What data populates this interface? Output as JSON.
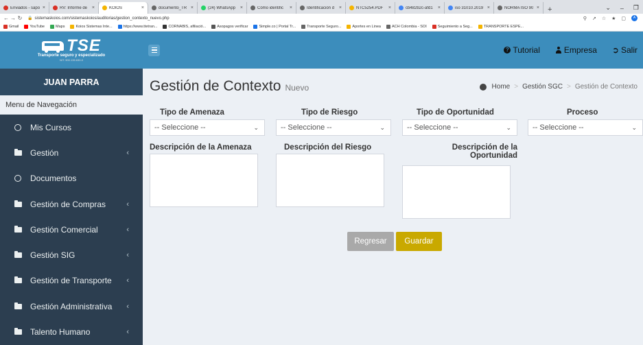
{
  "browser": {
    "tabs": [
      {
        "label": "Enviados - sapo",
        "color": "#d93025"
      },
      {
        "label": "RV: Informe de",
        "color": "#d93025"
      },
      {
        "label": "KOIOS",
        "color": "#f4b400",
        "active": true
      },
      {
        "label": "documento_TR",
        "color": "#666666"
      },
      {
        "label": "(24) WhatsApp",
        "color": "#25d366"
      },
      {
        "label": "Cómo identific",
        "color": "#666666"
      },
      {
        "label": "Identificación d",
        "color": "#666666"
      },
      {
        "label": "NTC5254.PDF",
        "color": "#f4b400"
      },
      {
        "label": "cb482b2c-afd1",
        "color": "#4285f4"
      },
      {
        "label": "iso 31010.2019",
        "color": "#4285f4"
      },
      {
        "label": "NORMA ISO 90",
        "color": "#666666"
      }
    ],
    "url": "sistemaskoios.com/sistemaskoios/auditorias/gestion_contexto_nuevo.php",
    "profile_initial": "A",
    "bookmarks": [
      {
        "label": "Gmail",
        "color": "#d93025"
      },
      {
        "label": "YouTube",
        "color": "#ff0000"
      },
      {
        "label": "Maps",
        "color": "#34a853"
      },
      {
        "label": "Koios Sistemas Inte...",
        "color": "#f4b400"
      },
      {
        "label": "https://www.ttetran...",
        "color": "#1a73e8"
      },
      {
        "label": "CORNABIS, afiliació...",
        "color": "#333333"
      },
      {
        "label": "Asopagos verificar",
        "color": "#555555"
      },
      {
        "label": "Simple.co | Portal Tr...",
        "color": "#1a73e8"
      },
      {
        "label": "Transporte Seguro...",
        "color": "#666666"
      },
      {
        "label": "Aportes en Linea",
        "color": "#f4b400"
      },
      {
        "label": "ACH Colombia - SOI",
        "color": "#666666"
      },
      {
        "label": "Seguimiento a Seg...",
        "color": "#d93025"
      },
      {
        "label": "TRANSPORTE ESPE...",
        "color": "#f4b400"
      }
    ]
  },
  "brand": {
    "name": "TSE",
    "subtitle": "Transporte seguro y especializado",
    "nit": "NIT: 900.135.630-0"
  },
  "sidebar": {
    "user": "JUAN PARRA",
    "menu_header": "Menu de Navegación",
    "items": [
      {
        "label": "Mis Cursos",
        "icon": "circle-icon",
        "chevron": false
      },
      {
        "label": "Gestión",
        "icon": "folder-icon",
        "chevron": true
      },
      {
        "label": "Documentos",
        "icon": "circle-icon",
        "chevron": false
      },
      {
        "label": "Gestión de Compras",
        "icon": "folder-icon",
        "chevron": true
      },
      {
        "label": "Gestión Comercial",
        "icon": "folder-icon",
        "chevron": true
      },
      {
        "label": "Gestión SIG",
        "icon": "folder-icon",
        "chevron": true
      },
      {
        "label": "Gestión de Transporte",
        "icon": "folder-icon",
        "chevron": true
      },
      {
        "label": "Gestión Administrativa",
        "icon": "folder-icon",
        "chevron": true
      },
      {
        "label": "Talento Humano",
        "icon": "folder-icon",
        "chevron": true
      }
    ]
  },
  "topbar": {
    "tutorial": "Tutorial",
    "empresa": "Empresa",
    "salir": "Salir"
  },
  "page": {
    "title": "Gestión de Contexto",
    "subtitle": "Nuevo",
    "breadcrumb": {
      "home": "Home",
      "section": "Gestión SGC",
      "current": "Gestión de Contexto"
    }
  },
  "form": {
    "tipo_amenaza": {
      "label": "Tipo de Amenaza",
      "value": "-- Seleccione --"
    },
    "tipo_riesgo": {
      "label": "Tipo de Riesgo",
      "value": "-- Seleccione --"
    },
    "tipo_oportunidad": {
      "label": "Tipo de Oportunidad",
      "value": "-- Seleccione --"
    },
    "proceso": {
      "label": "Proceso",
      "value": "-- Seleccione --"
    },
    "desc_amenaza": {
      "label": "Descripción de la Amenaza"
    },
    "desc_riesgo": {
      "label": "Descripción del Riesgo"
    },
    "desc_oportunidad": {
      "label_line1": "Descripción de la",
      "label_line2": "Oportunidad"
    },
    "regresar": "Regresar",
    "guardar": "Guardar"
  },
  "colors": {
    "header_blue": "#3c8dbc",
    "sidebar_dark": "#2c3e50",
    "save_gold": "#c9a900",
    "back_gray": "#a9a9a9"
  }
}
